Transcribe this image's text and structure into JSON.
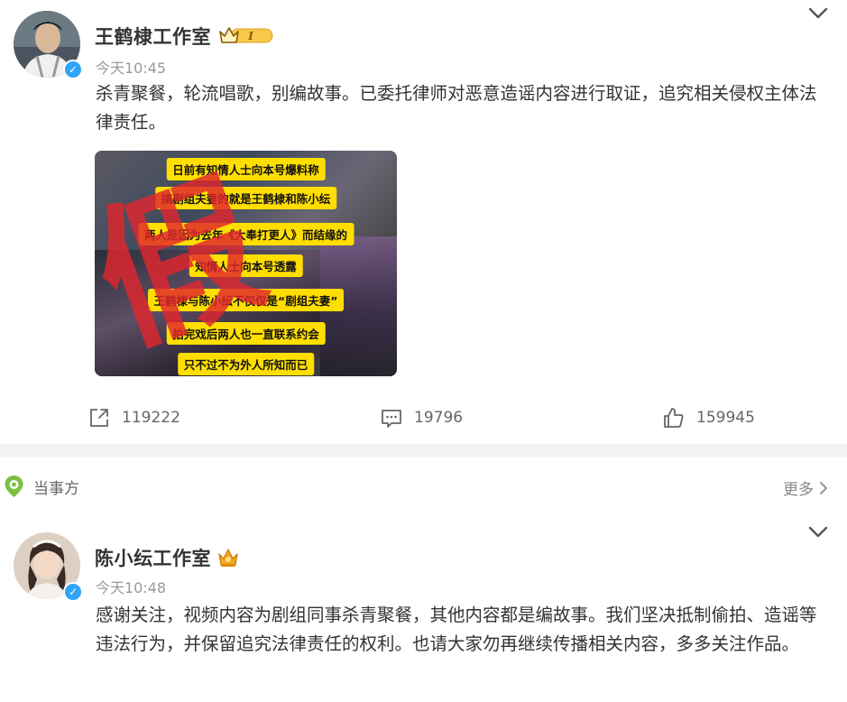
{
  "post1": {
    "username": "王鹤棣工作室",
    "level_badge": "I",
    "time": "今天10:45",
    "text": "杀青聚餐，轮流唱歌，别编故事。已委托律师对恶意造谣内容进行取证，追究相关侵权主体法律责任。",
    "image": {
      "captions": [
        "日前有知情人士向本号爆料称",
        "搞剧组夫妻的就是王鹤棣和陈小纭",
        "两人是因为去年《大奉打更人》而结缘的",
        "知情人士向本号透露",
        "王鹤棣与陈小纭不仅仅是“剧组夫妻”",
        "拍完戏后两人也一直联系约会",
        "只不过不为外人所知而已"
      ],
      "stamp_text": "假"
    },
    "actions": {
      "share_count": "119222",
      "comment_count": "19796",
      "like_count": "159945"
    }
  },
  "party_section": {
    "label": "当事方",
    "more_label": "更多"
  },
  "post2": {
    "username": "陈小纭工作室",
    "time": "今天10:48",
    "text": "感谢关注，视频内容为剧组同事杀青聚餐，其他内容都是编故事。我们坚决抵制偷拍、造谣等违法行为，并保留追究法律责任的权利。也请大家勿再继续传播相关内容，多多关注作品。"
  },
  "colors": {
    "verified_blue": "#2fa3f7",
    "caption_yellow": "#ffde00",
    "stamp_red": "#e0262d",
    "party_green": "#7bc043",
    "crown_gold": "#f5a623"
  },
  "icons": {
    "verified": "verified-badge-icon",
    "collapse": "chevron-down-icon",
    "share": "share-icon",
    "comment": "comment-icon",
    "like": "thumbs-up-icon",
    "party": "location-pin-icon",
    "more_arrow": "chevron-right-icon"
  }
}
